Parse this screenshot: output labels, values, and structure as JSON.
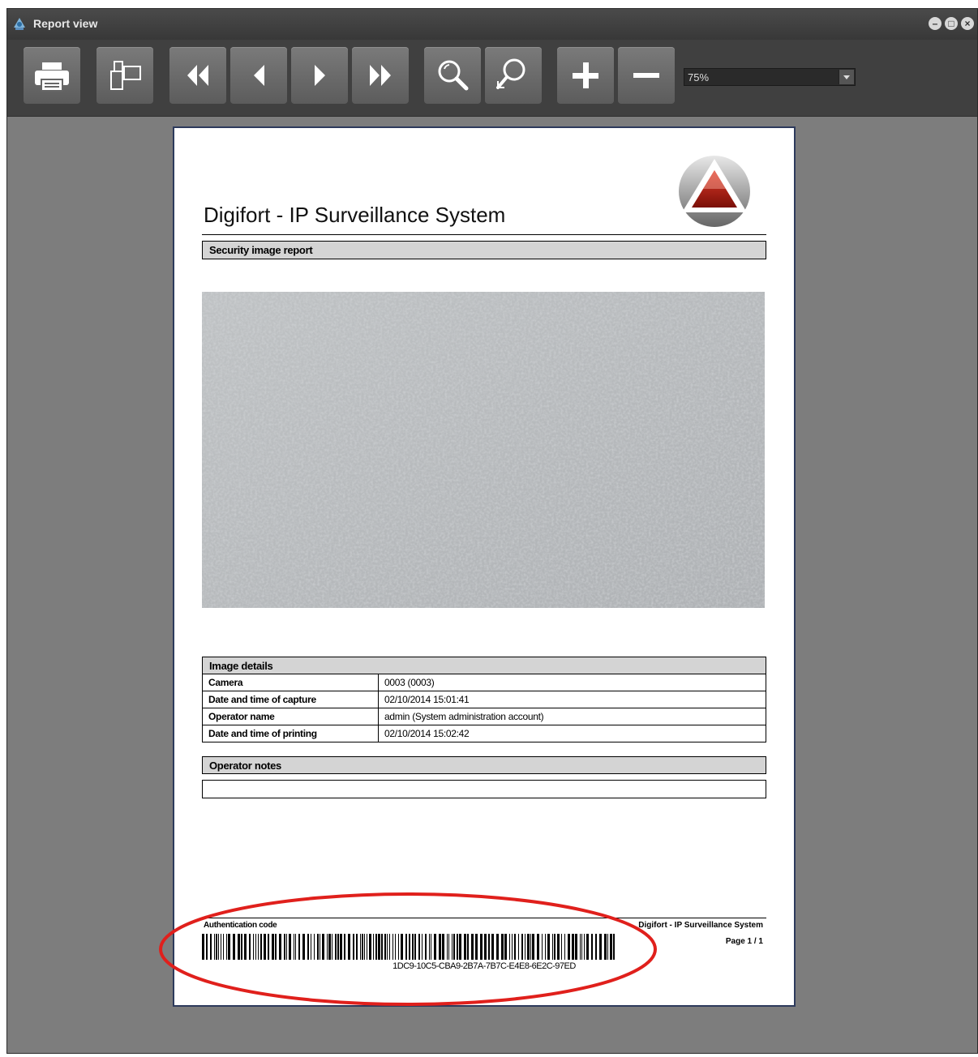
{
  "window": {
    "title": "Report view",
    "controls": [
      "minimize-icon",
      "restore-icon",
      "close-icon"
    ]
  },
  "toolbar": {
    "buttons": [
      {
        "name": "print-button",
        "icon": "printer-icon"
      },
      {
        "name": "page-setup-button",
        "icon": "pages-icon"
      },
      {
        "name": "first-page-button",
        "icon": "double-left-arrow-icon"
      },
      {
        "name": "previous-page-button",
        "icon": "left-arrow-icon"
      },
      {
        "name": "next-page-button",
        "icon": "right-arrow-icon"
      },
      {
        "name": "last-page-button",
        "icon": "double-right-arrow-icon"
      },
      {
        "name": "zoom-fit-button",
        "icon": "magnifier-icon"
      },
      {
        "name": "zoom-page-button",
        "icon": "magnifier-expand-icon"
      },
      {
        "name": "zoom-in-button",
        "icon": "plus-icon"
      },
      {
        "name": "zoom-out-button",
        "icon": "minus-icon"
      }
    ],
    "zoom_value": "75%"
  },
  "report": {
    "title": "Digifort - IP Surveillance System",
    "section_title": "Security image report",
    "image_details_title": "Image details",
    "details": [
      {
        "label": "Camera",
        "value": "0003 (0003)"
      },
      {
        "label": "Date and time of capture",
        "value": "02/10/2014 15:01:41"
      },
      {
        "label": "Operator name",
        "value": "admin (System administration account)"
      },
      {
        "label": "Date and time of printing",
        "value": "02/10/2014 15:02:42"
      }
    ],
    "operator_notes_title": "Operator notes",
    "operator_notes": "",
    "footer": {
      "auth_label": "Authentication code",
      "auth_code": "1DC9-10C5-CBA9-2B7A-7B7C-E4E8-6E2C-97ED",
      "system_name": "Digifort - IP Surveillance System",
      "page": "Page 1 / 1"
    }
  },
  "colors": {
    "annotation_circle": "#e0201c",
    "workspace": "#7d7d7d",
    "toolbar": "#404040"
  }
}
